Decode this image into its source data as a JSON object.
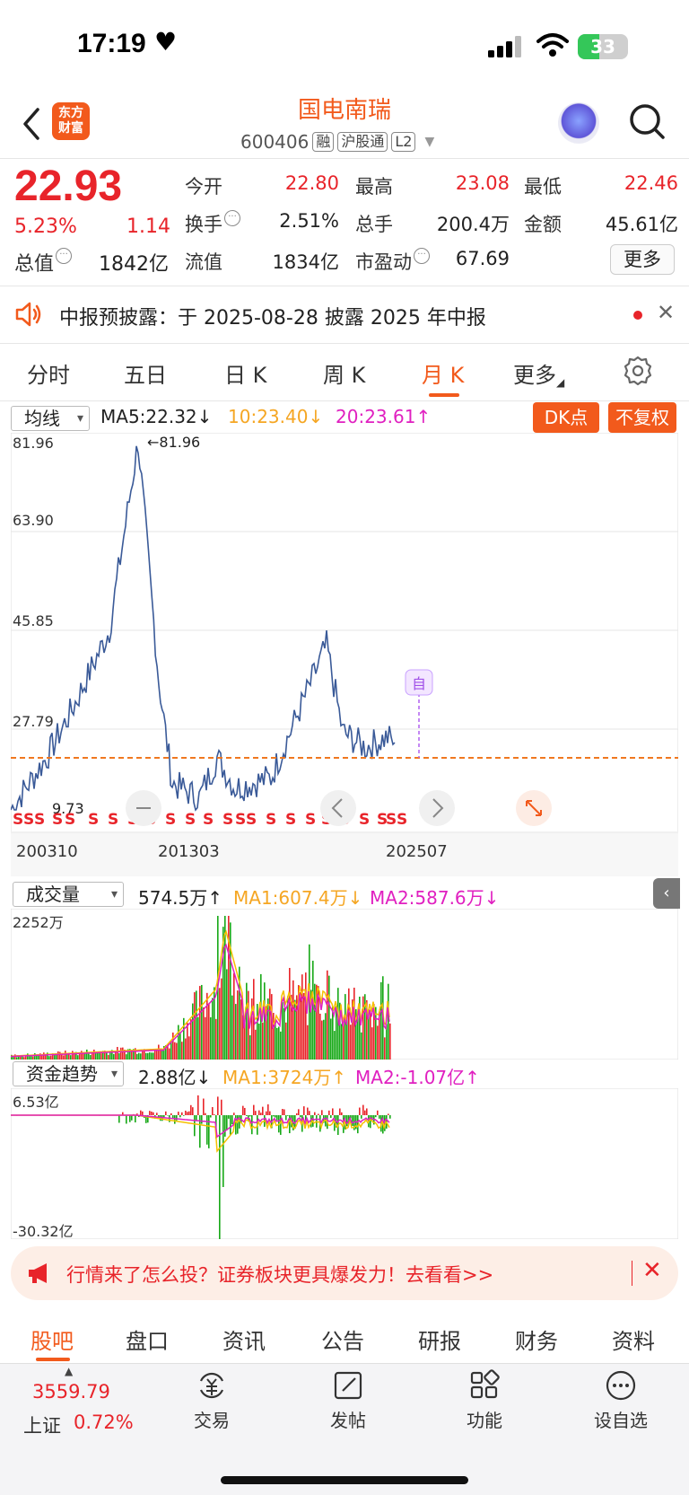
{
  "status": {
    "time": "17:19",
    "battery": "33"
  },
  "header": {
    "name": "国电南瑞",
    "code": "600406",
    "tags": [
      "融",
      "沪股通",
      "L2"
    ],
    "logo_text": [
      "东方",
      "财富"
    ]
  },
  "quote": {
    "price": "22.93",
    "pct": "5.23%",
    "change": "1.14",
    "total_label": "总值",
    "total_value": "1842亿",
    "rows": [
      [
        {
          "label": "今开",
          "value": "22.80",
          "color": "#e8242a"
        },
        {
          "label": "最高",
          "value": "23.08",
          "color": "#e8242a"
        },
        {
          "label": "最低",
          "value": "22.46",
          "color": "#e8242a"
        }
      ],
      [
        {
          "label": "换手",
          "value": "2.51%",
          "color": "#222"
        },
        {
          "label": "总手",
          "value": "200.4万",
          "color": "#222"
        },
        {
          "label": "金额",
          "value": "45.61亿",
          "color": "#222"
        }
      ],
      [
        {
          "label": "流值",
          "value": "1834亿",
          "color": "#222"
        },
        {
          "label": "市盈动",
          "value": "67.69",
          "color": "#222"
        }
      ]
    ],
    "more": "更多"
  },
  "notice": {
    "text": "中报预披露：于 2025-08-28 披露 2025 年中报"
  },
  "period_tabs": [
    "分时",
    "五日",
    "日 K",
    "周 K",
    "月 K",
    "更多"
  ],
  "active_period": "月 K",
  "main_indicator": {
    "selector": "均线",
    "ma5": "MA5:22.32↓",
    "ma10": "10:23.40↓",
    "ma20": "20:23.61↑",
    "dk_button": "DK点",
    "fq_button": "不复权"
  },
  "main_chart": {
    "y_labels": [
      "81.96",
      "63.90",
      "45.85",
      "27.79"
    ],
    "x_labels": [
      "200310",
      "201303",
      "202507"
    ],
    "max_marker": "←81.96",
    "min_marker": "9.73",
    "self_marker": "自",
    "current_line_color": "#f07820"
  },
  "volume": {
    "selector": "成交量",
    "value": "574.5万↑",
    "ma1": "MA1:607.4万↓",
    "ma2": "MA2:587.6万↓",
    "y_max": "2252万"
  },
  "fund": {
    "selector": "资金趋势",
    "value": "2.88亿↓",
    "ma1": "MA1:3724万↑",
    "ma2": "MA2:-1.07亿↑",
    "y_max": "6.53亿",
    "y_min": "-30.32亿"
  },
  "ad": {
    "text": "行情来了怎么投？证券板块更具爆发力！去看看>>"
  },
  "bottom_tabs": [
    "股吧",
    "盘口",
    "资讯",
    "公告",
    "研报",
    "财务",
    "资料"
  ],
  "index": {
    "value": "3559.79",
    "name": "上证",
    "pct": "0.72%"
  },
  "bottom_nav": [
    "交易",
    "发帖",
    "功能",
    "设自选"
  ],
  "colors": {
    "accent": "#f25a1c",
    "up": "#e8242a",
    "down": "#17a817",
    "price_line": "#3a5a98",
    "ma_yellow": "#f5a623",
    "ma_magenta": "#e020c0"
  },
  "chart_data": {
    "type": "line",
    "title": "",
    "x": [
      "200310",
      "201303",
      "202507"
    ],
    "series": [
      {
        "values": [
          9.73,
          20,
          30,
          45,
          81.96,
          35,
          15,
          12,
          20,
          14,
          16,
          42,
          25,
          22,
          24,
          22.93
        ]
      }
    ],
    "ylim": [
      9.73,
      81.96
    ],
    "grid": true
  }
}
